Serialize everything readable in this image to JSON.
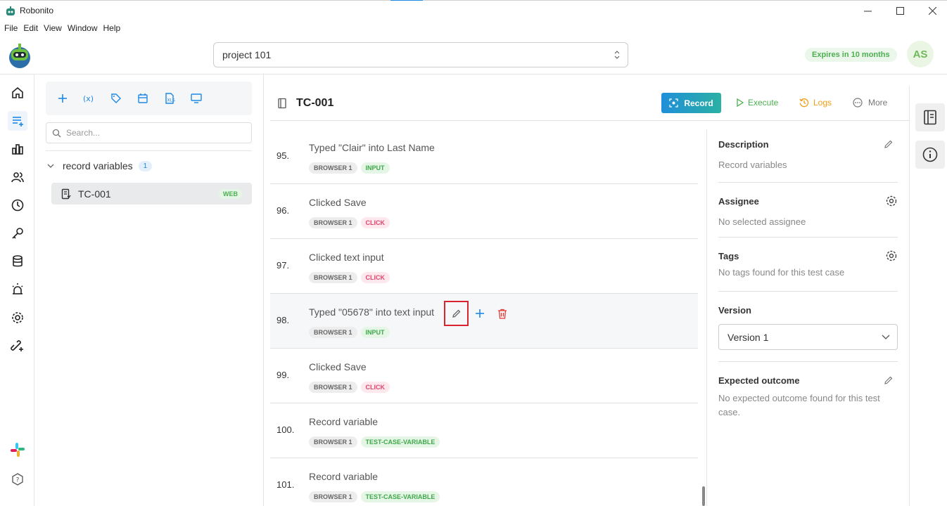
{
  "window": {
    "title": "Robonito"
  },
  "menu": [
    "File",
    "Edit",
    "View",
    "Window",
    "Help"
  ],
  "header": {
    "project": "project 101",
    "expires": "Expires in 10 months",
    "avatar": "AS"
  },
  "tree": {
    "search_placeholder": "Search...",
    "folder": {
      "name": "record variables",
      "count": "1"
    },
    "item": {
      "name": "TC-001",
      "badge": "WEB"
    }
  },
  "main": {
    "title": "TC-001",
    "buttons": {
      "record": "Record",
      "execute": "Execute",
      "logs": "Logs",
      "more": "More"
    },
    "steps": [
      {
        "num": "95.",
        "title": "Typed \"Clair\" into Last Name",
        "browser": "BROWSER 1",
        "action": "INPUT"
      },
      {
        "num": "96.",
        "title": "Clicked Save",
        "browser": "BROWSER 1",
        "action": "CLICK"
      },
      {
        "num": "97.",
        "title": "Clicked text input",
        "browser": "BROWSER 1",
        "action": "CLICK"
      },
      {
        "num": "98.",
        "title": "Typed \"05678\" into text input",
        "browser": "BROWSER 1",
        "action": "INPUT"
      },
      {
        "num": "99.",
        "title": "Clicked Save",
        "browser": "BROWSER 1",
        "action": "CLICK"
      },
      {
        "num": "100.",
        "title": "Record variable",
        "browser": "BROWSER 1",
        "action": "TEST-CASE-VARIABLE"
      },
      {
        "num": "101.",
        "title": "Record variable",
        "browser": "BROWSER 1",
        "action": "TEST-CASE-VARIABLE"
      }
    ]
  },
  "details": {
    "description": {
      "label": "Description",
      "value": "Record variables"
    },
    "assignee": {
      "label": "Assignee",
      "value": "No selected assignee"
    },
    "tags": {
      "label": "Tags",
      "value": "No tags found for this test case"
    },
    "version": {
      "label": "Version",
      "value": "Version 1"
    },
    "expected": {
      "label": "Expected outcome",
      "value": "No expected outcome found for this test case."
    }
  },
  "colors": {
    "accent": "#1e88e5",
    "record_start": "#1f8fd9",
    "record_end": "#2bb0a4",
    "highlight": "#d9232e"
  }
}
